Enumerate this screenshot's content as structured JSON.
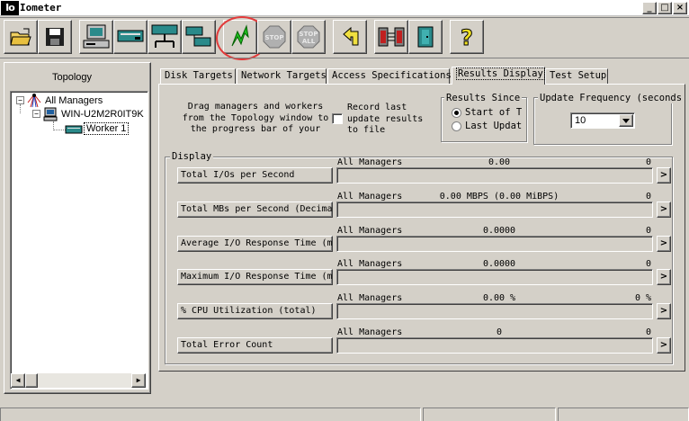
{
  "app": {
    "icon_text": "Io",
    "title": "Iometer"
  },
  "window_controls": {
    "minimize": "_",
    "maximize": "□",
    "close": "×"
  },
  "toolbar": {
    "buttons": [
      "open-icon",
      "save-icon",
      "display-icon",
      "new-worker-icon",
      "network-worker-icon",
      "duplicate-worker-icon",
      "start-icon",
      "stop-icon",
      "stop-all-icon",
      "reset-icon",
      "disconnect-icon",
      "exit-icon",
      "help-icon"
    ],
    "stop_label": "STOP",
    "stop_all_top": "STOP",
    "stop_all_bottom": "ALL",
    "help_label": "?",
    "highlight_color": "#e23a3a"
  },
  "topology": {
    "label": "Topology",
    "tree": [
      {
        "label": "All Managers",
        "expander": "⊟"
      },
      {
        "label": "WIN-U2M2R0IT9K",
        "expander": "⊟"
      },
      {
        "label": "Worker 1"
      }
    ]
  },
  "tabs": [
    "Disk Targets",
    "Network Targets",
    "Access Specifications",
    "Results Display",
    "Test Setup"
  ],
  "results": {
    "drag_hint": "Drag managers and workers from the Topology window to the progress bar of your",
    "record_label": "Record last update results to file",
    "record_checked": false,
    "results_since": {
      "title": "Results Since",
      "options": [
        "Start of T",
        "Last Updat"
      ],
      "selected": "Start of T"
    },
    "update_frequency": {
      "title": "Update Frequency (seconds)",
      "value": "10"
    },
    "display_title": "Display",
    "metrics": [
      {
        "button": "Total I/Os per Second",
        "scope": "All Managers",
        "value": "0.00",
        "right": "0"
      },
      {
        "button": "Total MBs per Second (Decimal)",
        "scope": "All Managers",
        "value": "0.00 MBPS (0.00 MiBPS)",
        "right": "0"
      },
      {
        "button": "Average I/O Response Time (ms)",
        "scope": "All Managers",
        "value": "0.0000",
        "right": "0"
      },
      {
        "button": "Maximum I/O Response Time (ms)",
        "scope": "All Managers",
        "value": "0.0000",
        "right": "0"
      },
      {
        "button": "% CPU Utilization (total)",
        "scope": "All Managers",
        "value": "0.00 %",
        "right": "0 %"
      },
      {
        "button": "Total Error Count",
        "scope": "All Managers",
        "value": "0",
        "right": "0"
      }
    ],
    "arrow": ">"
  },
  "scroll_arrows": {
    "left": "◀",
    "right": "▶"
  }
}
